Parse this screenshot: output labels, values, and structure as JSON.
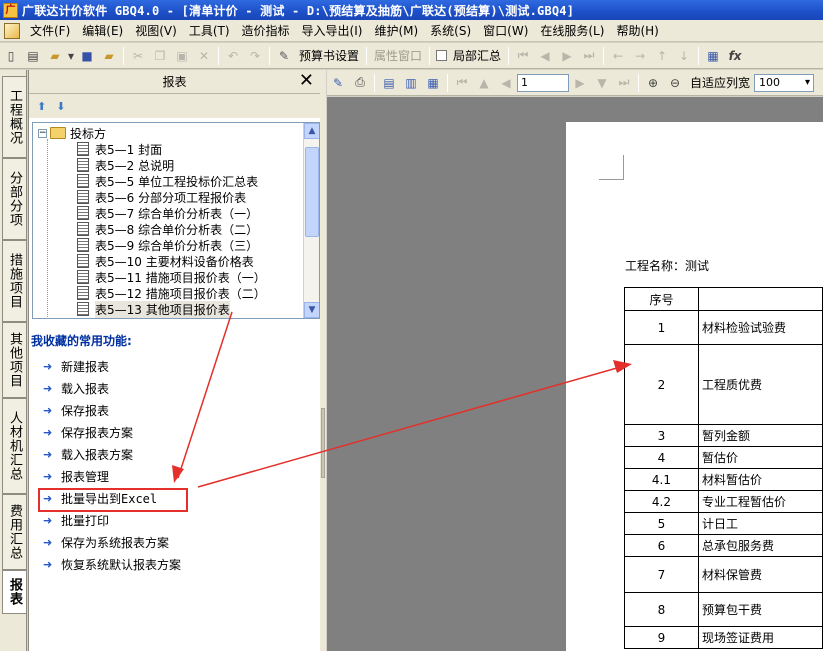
{
  "window": {
    "title": "广联达计价软件 GBQ4.0 - [清单计价 - 测试 - D:\\预结算及抽筋\\广联达(预结算)\\测试.GBQ4]"
  },
  "menubar": {
    "items": [
      "文件(F)",
      "编辑(E)",
      "视图(V)",
      "工具(T)",
      "造价指标",
      "导入导出(I)",
      "维护(M)",
      "系统(S)",
      "窗口(W)",
      "在线服务(L)",
      "帮助(H)"
    ]
  },
  "toolbar": {
    "budget_setting": "预算书设置",
    "attr_window": "属性窗口",
    "summary": "局部汇总"
  },
  "vertical_tabs": [
    "工程概况",
    "分部分项",
    "措施项目",
    "其他项目",
    "人材机汇总",
    "费用汇总",
    "报表"
  ],
  "panel": {
    "title": "报表",
    "tree": {
      "root": "投标方",
      "items": [
        "表5—1  封面",
        "表5—2  总说明",
        "表5—5  单位工程投标价汇总表",
        "表5—6  分部分项工程报价表",
        "表5—7  综合单价分析表（一）",
        "表5—8  综合单价分析表（二）",
        "表5—9  综合单价分析表（三）",
        "表5—10  主要材料设备价格表",
        "表5—11  措施项目报价表（一）",
        "表5—12  措施项目报价表（二）",
        "表5—13  其他项目报价表"
      ]
    },
    "favorites_title": "我收藏的常用功能:",
    "favorites": [
      "新建报表",
      "载入报表",
      "保存报表",
      "保存报表方案",
      "载入报表方案",
      "报表管理",
      "批量导出到Excel",
      "批量打印",
      "保存为系统报表方案",
      "恢复系统默认报表方案"
    ]
  },
  "viewer": {
    "page_number": "1",
    "fit_width_label": "自适应列宽",
    "zoom": "100",
    "report": {
      "project_label": "工程名称：测试",
      "header_seq": "序号",
      "rows": [
        {
          "seq": "1",
          "name": "材料检验试验费"
        },
        {
          "seq": "2",
          "name": "工程质优费"
        },
        {
          "seq": "3",
          "name": "暂列金额"
        },
        {
          "seq": "4",
          "name": "暂估价"
        },
        {
          "seq": "4.1",
          "name": "材料暂估价"
        },
        {
          "seq": "4.2",
          "name": "专业工程暂估价"
        },
        {
          "seq": "5",
          "name": "计日工"
        },
        {
          "seq": "6",
          "name": "总承包服务费"
        },
        {
          "seq": "7",
          "name": "材料保管费"
        },
        {
          "seq": "8",
          "name": "预算包干费"
        },
        {
          "seq": "9",
          "name": "现场签证费用"
        }
      ]
    }
  },
  "colors": {
    "annotation": "#e3302b",
    "title_bar": "#1c4fc8",
    "favorites_title": "#0030a0"
  }
}
